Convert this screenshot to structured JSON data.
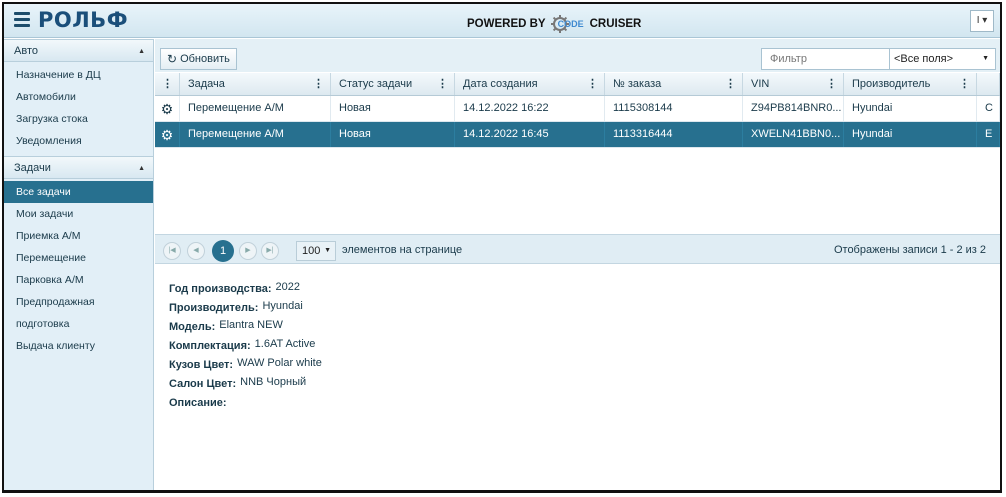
{
  "header": {
    "logo_text": "РОЛЬФ",
    "powered_prefix": "POWERED BY",
    "powered_badge": "CODE",
    "powered_suffix": "CRUISER",
    "lang_toggle": "I ▾"
  },
  "sidebar": {
    "groups": [
      {
        "title": "Авто",
        "items": [
          "Назначение в ДЦ",
          "Автомобили",
          "Загрузка стока",
          "Уведомления"
        ]
      },
      {
        "title": "Задачи",
        "items": [
          "Все задачи",
          "Мои задачи",
          "Приемка А/М",
          "Перемещение",
          "Парковка А/М",
          "Предпродажная",
          "подготовка",
          "Выдача клиенту"
        ]
      }
    ],
    "active_item": "Все задачи"
  },
  "toolbar": {
    "refresh_label": "Обновить",
    "filter_placeholder": "Фильтр",
    "fields_select_value": "<Все поля>"
  },
  "grid": {
    "columns": [
      "Задача",
      "Статус задачи",
      "Дата создания",
      "№ заказа",
      "VIN",
      "Производитель"
    ],
    "rows": [
      {
        "task": "Перемещение А/М",
        "status": "Новая",
        "created": "14.12.2022 16:22",
        "order": "1115308144",
        "vin": "Z94PB814BNR0...",
        "maker": "Hyundai",
        "extra": "C",
        "selected": false
      },
      {
        "task": "Перемещение А/М",
        "status": "Новая",
        "created": "14.12.2022 16:45",
        "order": "1113316444",
        "vin": "XWELN41BBN0...",
        "maker": "Hyundai",
        "extra": "E",
        "selected": true
      }
    ]
  },
  "pager": {
    "current_page": "1",
    "page_size": "100",
    "page_size_label": "элементов на странице",
    "info": "Отображены записи 1 - 2 из 2"
  },
  "details": {
    "fields": [
      {
        "label": "Год производства:",
        "value": "2022"
      },
      {
        "label": "Производитель:",
        "value": "Hyundai"
      },
      {
        "label": "Модель:",
        "value": "Elantra NEW"
      },
      {
        "label": "Комплектация:",
        "value": "1.6AT Active"
      },
      {
        "label": "Кузов Цвет:",
        "value": "WAW Polar white"
      },
      {
        "label": "Салон Цвет:",
        "value": "NNB Чорный"
      },
      {
        "label": "Описание:",
        "value": ""
      }
    ]
  },
  "colors": {
    "accent": "#27708f",
    "sidebar_bg": "#e2eff7",
    "header_bg": "#d2e6f0"
  }
}
